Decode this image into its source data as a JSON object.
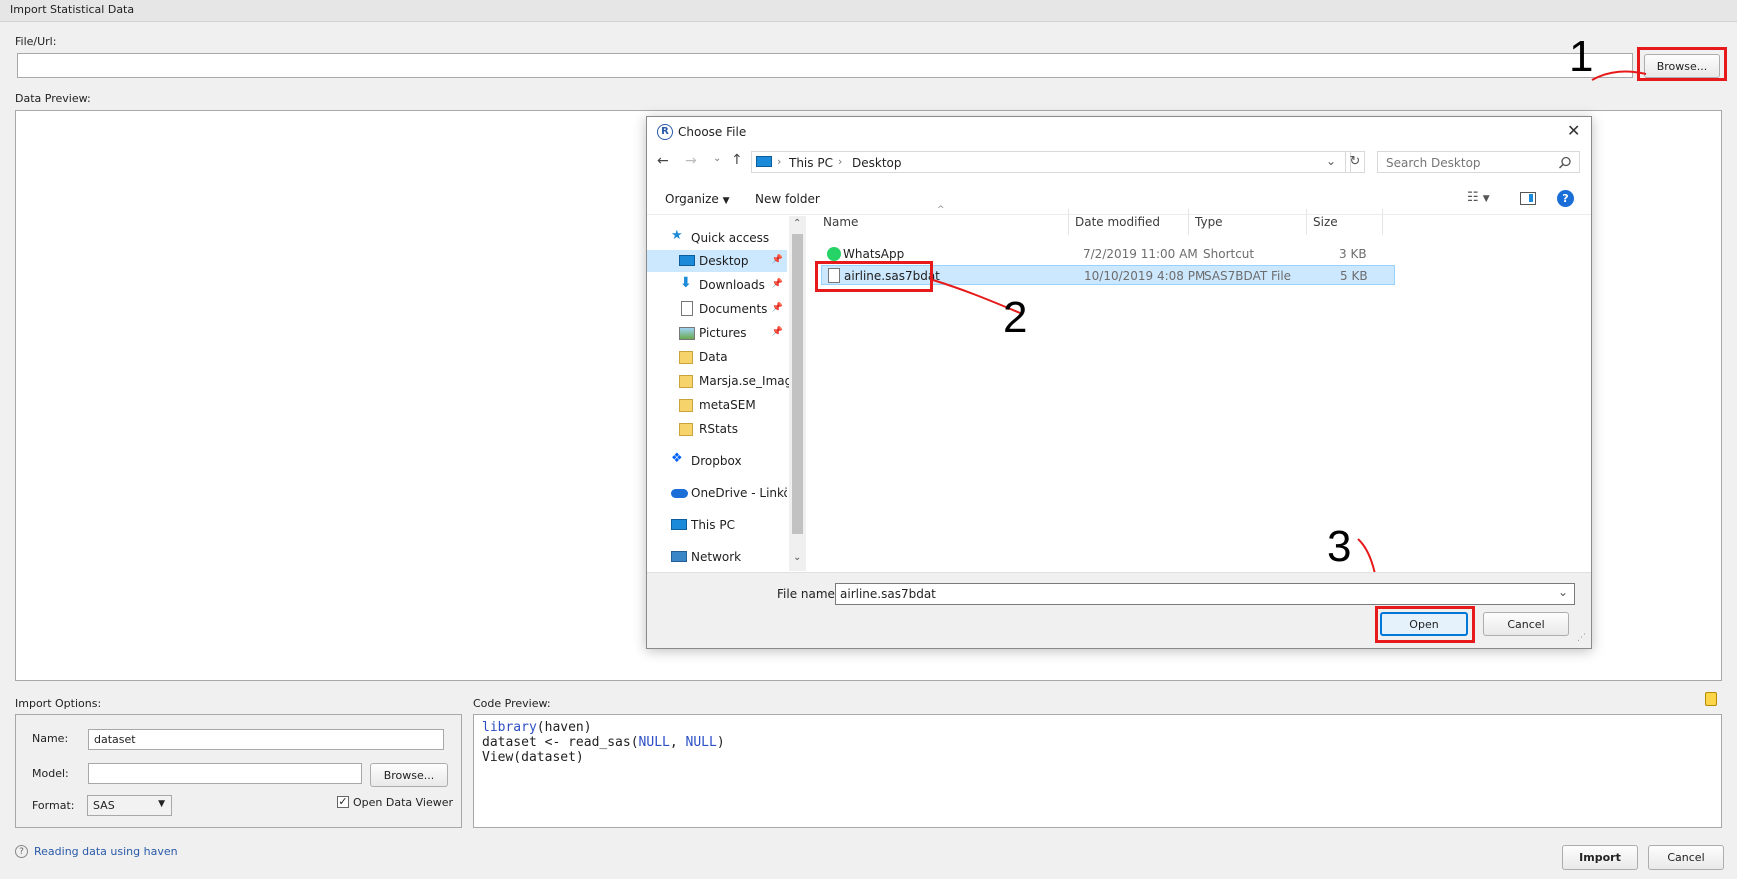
{
  "window": {
    "title": "Import Statistical Data"
  },
  "file_url": {
    "label": "File/Url:",
    "value": "",
    "browse_label": "Browse..."
  },
  "data_preview": {
    "label": "Data Preview:"
  },
  "annotations": {
    "n1": "1",
    "n2": "2",
    "n3": "3",
    "accent": "#e61a1a"
  },
  "dialog": {
    "title": "Choose File",
    "breadcrumb": [
      "This PC",
      "Desktop"
    ],
    "search_placeholder": "Search Desktop",
    "organize_label": "Organize",
    "new_folder_label": "New folder",
    "nav": [
      {
        "label": "Quick access",
        "icon": "star-icon"
      },
      {
        "label": "Desktop",
        "icon": "desktop-icon",
        "pinned": true,
        "selected": true
      },
      {
        "label": "Downloads",
        "icon": "download-icon",
        "pinned": true
      },
      {
        "label": "Documents",
        "icon": "document-icon",
        "pinned": true
      },
      {
        "label": "Pictures",
        "icon": "pictures-icon",
        "pinned": true
      },
      {
        "label": "Data",
        "icon": "folder-icon"
      },
      {
        "label": "Marsja.se_Image",
        "icon": "folder-icon"
      },
      {
        "label": "metaSEM",
        "icon": "folder-icon"
      },
      {
        "label": "RStats",
        "icon": "folder-icon"
      },
      {
        "label": "Dropbox",
        "icon": "dropbox-icon"
      },
      {
        "label": "OneDrive - Linköp",
        "icon": "onedrive-icon"
      },
      {
        "label": "This PC",
        "icon": "computer-icon"
      },
      {
        "label": "Network",
        "icon": "network-icon"
      }
    ],
    "columns": {
      "name": "Name",
      "date": "Date modified",
      "type": "Type",
      "size": "Size"
    },
    "files": [
      {
        "name": "WhatsApp",
        "date": "7/2/2019 11:00 AM",
        "type": "Shortcut",
        "size": "3 KB",
        "icon": "whatsapp-icon"
      },
      {
        "name": "airline.sas7bdat",
        "date": "10/10/2019 4:08 PM",
        "type": "SAS7BDAT File",
        "size": "5 KB",
        "icon": "file-icon",
        "selected": true
      }
    ],
    "file_name_label": "File name:",
    "file_name_value": "airline.sas7bdat",
    "open_label": "Open",
    "cancel_label": "Cancel"
  },
  "import_options": {
    "label": "Import Options:",
    "name_label": "Name:",
    "name_value": "dataset",
    "model_label": "Model:",
    "model_value": "",
    "browse_label": "Browse...",
    "format_label": "Format:",
    "format_value": "SAS",
    "open_viewer_label": "Open Data Viewer",
    "open_viewer_checked": true
  },
  "code_preview": {
    "label": "Code Preview:",
    "line1_fn": "library",
    "line1_rest": "(haven)",
    "line2_a": "dataset <- read_sas(",
    "line2_null1": "NULL",
    "line2_sep": ", ",
    "line2_null2": "NULL",
    "line2_end": ")",
    "line3": "View(dataset)"
  },
  "footer": {
    "help_link": "Reading data using haven",
    "import_label": "Import",
    "cancel_label": "Cancel"
  }
}
